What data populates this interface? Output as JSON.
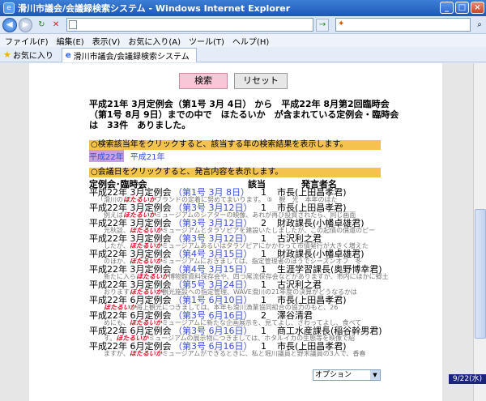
{
  "window": {
    "title": "滑川市議会/会議録検索システム - Windows Internet Explorer"
  },
  "nav": {
    "back_icon": "back-arrow-icon",
    "forward_icon": "forward-arrow-icon",
    "refresh_icon": "refresh-icon",
    "stop_icon": "stop-icon",
    "search_brand": "live-search-icon"
  },
  "menu": {
    "items": [
      "ファイル(F)",
      "編集(E)",
      "表示(V)",
      "お気に入り(A)",
      "ツール(T)",
      "ヘルプ(H)"
    ]
  },
  "favorites": {
    "label": "お気に入り"
  },
  "tab": {
    "label": "滑川市議会/会議録検索システム"
  },
  "page": {
    "search_button": "検索",
    "reset_button": "リセット",
    "summary": [
      "平成21年 3月定例会（第1号 3月 4日） から　平成22年 8月第2回臨時会",
      "（第1号 8月 9日）までの中で　ほたるいか　が含まれている定例会・臨時会",
      "は　33件　ありました。"
    ],
    "year_instruction": "○検索該当年をクリックすると、該当する年の検索結果を表示します。",
    "years": [
      "平成22年",
      "平成21年"
    ],
    "date_instruction": "○会議日をクリックすると、発言内容を表示します。",
    "headers": {
      "session": "定例会･臨時会",
      "count": "該当",
      "speaker": "発言者名"
    },
    "rows": [
      {
        "session": "平成22年 3月定例会",
        "date": "（第1号 3月 8日）",
        "count": "1",
        "speaker": "市長(上田昌孝君)",
        "snip_pre": "「滑川の",
        "snip_hl": "ほたるいか",
        "snip_post": "ブランドの定着に努めてまいります。 ⑤　観　光　本年のほた"
      },
      {
        "session": "平成22年 3月定例会",
        "date": "（第3号 3月12日）",
        "count": "1",
        "speaker": "市長(上田昌孝君)",
        "snip_pre": "　例えば",
        "snip_hl": "ほたるいか",
        "snip_post": "ミュージアムのシアターの映像、あれが再び投資されたら、同じ画面"
      },
      {
        "session": "平成22年 3月定例会",
        "date": "（第3号 3月12日）",
        "count": "2",
        "speaker": "財政課長(小幡卓雄君)",
        "snip_pre": "　光秋談、",
        "snip_hl": "ほたるいか",
        "snip_post": "ミュージアムとタラソピアを建設いたしましたが、この起債の償還のピー"
      },
      {
        "session": "平成22年 3月定例会",
        "date": "（第3号 3月12日）",
        "count": "1",
        "speaker": "古沢利之君",
        "snip_pre": "　したが、",
        "snip_hl": "ほたるいか",
        "snip_post": "ミュージアムあるいはタラソピアにかかわって市債発行が大きく増えた"
      },
      {
        "session": "平成22年 3月定例会",
        "date": "（第4号 3月15日）",
        "count": "1",
        "speaker": "財政課長(小幡卓雄君)",
        "snip_pre": "　のほか、",
        "snip_hl": "ほたるいか",
        "snip_post": "ミュージアムにおきましては、指定管理者のほうでシーズンオフ　冬"
      },
      {
        "session": "平成22年 3月定例会",
        "date": "（第4号 3月15日）",
        "count": "1",
        "speaker": "生涯学習課長(奥野博幸君)",
        "snip_pre": "　新たに入ら",
        "snip_hl": "ほたるいか",
        "snip_post": "博物館資料保存会や、四つ尾流保存会などがありますが、市内にほかに郷土"
      },
      {
        "session": "平成22年 3月定例会",
        "date": "（第5号 3月24日）",
        "count": "1",
        "speaker": "古沢利之君",
        "snip_pre": "　おります",
        "snip_hl": "ほたるいか",
        "snip_post": "観光施設への指定管理、WAVE滑川の21年度の決算がどうなるかは"
      },
      {
        "session": "平成22年 6月定例会",
        "date": "（第1号 6月10日）",
        "count": "1",
        "speaker": "市長(上田昌孝君)",
        "snip_pre": "　",
        "snip_hl": "ほたるいか",
        "snip_post": "海上観光につきましては、本年も滑川漁業協同組合の協力のもと、26"
      },
      {
        "session": "平成22年 6月定例会",
        "date": "（第3号 6月16日）",
        "count": "2",
        "speaker": "澤谷清君",
        "snip_pre": "　めにも、",
        "snip_hl": "ほたるいか",
        "snip_post": "ミュージアムに新たな企画展示を、見てよし、さわってよし、食べて"
      },
      {
        "session": "平成22年 6月定例会",
        "date": "（第3号 6月16日）",
        "count": "1",
        "speaker": "商工水産課長(稲谷幹男君)",
        "snip_pre": "　す。",
        "snip_hl": "ほたるいか",
        "snip_post": "ミュージアムの展示物につきましては、ホタルイカの生態等を映像で紹"
      },
      {
        "session": "平成22年 6月定例会",
        "date": "（第3号 6月16日）",
        "count": "1",
        "speaker": "市長(上田昌孝君)",
        "snip_pre": "　ますが、",
        "snip_hl": "ほたるいか",
        "snip_post": "ミュージアムができるときに、私と堀川議員と野末議員の3人で、香春"
      }
    ],
    "option_label": "オプション"
  },
  "status": {
    "date_badge": "9/22(水)"
  }
}
